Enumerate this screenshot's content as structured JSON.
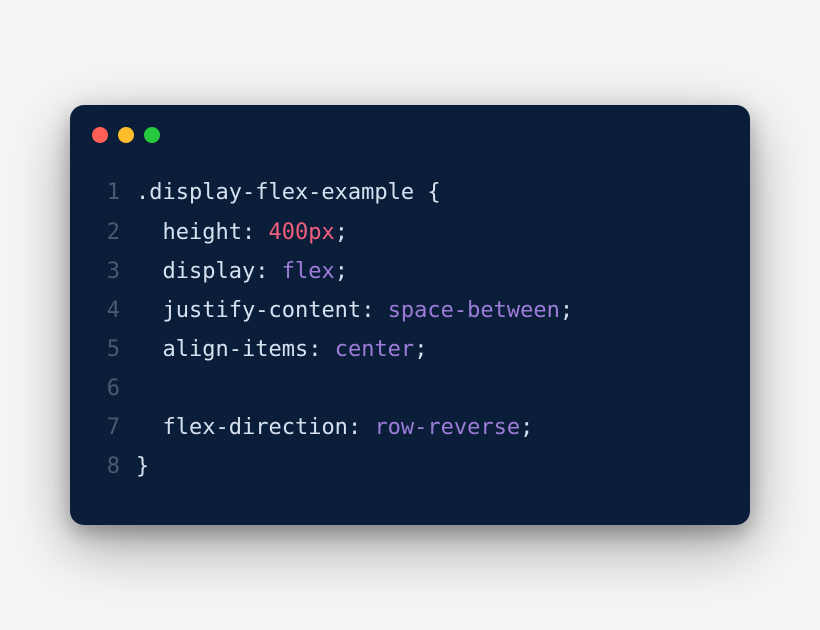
{
  "colors": {
    "bg": "#0a1e3a",
    "red": "#ff5f56",
    "yellow": "#ffbd2e",
    "green": "#27c93f",
    "lineNumber": "#4a5a70",
    "selector": "#d6e1ef",
    "punctuation": "#d6e1ef",
    "property": "#d6e1ef",
    "number": "#f25f7c",
    "value": "#9d7cd8"
  },
  "lines": [
    {
      "num": "1",
      "tokens": [
        {
          "t": ".display-flex-example ",
          "c": "tok-sel"
        },
        {
          "t": "{",
          "c": "tok-punc"
        }
      ]
    },
    {
      "num": "2",
      "tokens": [
        {
          "t": "  ",
          "c": "tok-punc"
        },
        {
          "t": "height",
          "c": "tok-prop"
        },
        {
          "t": ": ",
          "c": "tok-punc"
        },
        {
          "t": "400px",
          "c": "tok-num"
        },
        {
          "t": ";",
          "c": "tok-punc"
        }
      ]
    },
    {
      "num": "3",
      "tokens": [
        {
          "t": "  ",
          "c": "tok-punc"
        },
        {
          "t": "display",
          "c": "tok-prop"
        },
        {
          "t": ": ",
          "c": "tok-punc"
        },
        {
          "t": "flex",
          "c": "tok-val"
        },
        {
          "t": ";",
          "c": "tok-punc"
        }
      ]
    },
    {
      "num": "4",
      "tokens": [
        {
          "t": "  ",
          "c": "tok-punc"
        },
        {
          "t": "justify-content",
          "c": "tok-prop"
        },
        {
          "t": ": ",
          "c": "tok-punc"
        },
        {
          "t": "space-between",
          "c": "tok-val"
        },
        {
          "t": ";",
          "c": "tok-punc"
        }
      ]
    },
    {
      "num": "5",
      "tokens": [
        {
          "t": "  ",
          "c": "tok-punc"
        },
        {
          "t": "align-items",
          "c": "tok-prop"
        },
        {
          "t": ": ",
          "c": "tok-punc"
        },
        {
          "t": "center",
          "c": "tok-val"
        },
        {
          "t": ";",
          "c": "tok-punc"
        }
      ]
    },
    {
      "num": "6",
      "tokens": []
    },
    {
      "num": "7",
      "tokens": [
        {
          "t": "  ",
          "c": "tok-punc"
        },
        {
          "t": "flex-direction",
          "c": "tok-prop"
        },
        {
          "t": ": ",
          "c": "tok-punc"
        },
        {
          "t": "row-reverse",
          "c": "tok-val"
        },
        {
          "t": ";",
          "c": "tok-punc"
        }
      ]
    },
    {
      "num": "8",
      "tokens": [
        {
          "t": "}",
          "c": "tok-punc"
        }
      ]
    }
  ]
}
